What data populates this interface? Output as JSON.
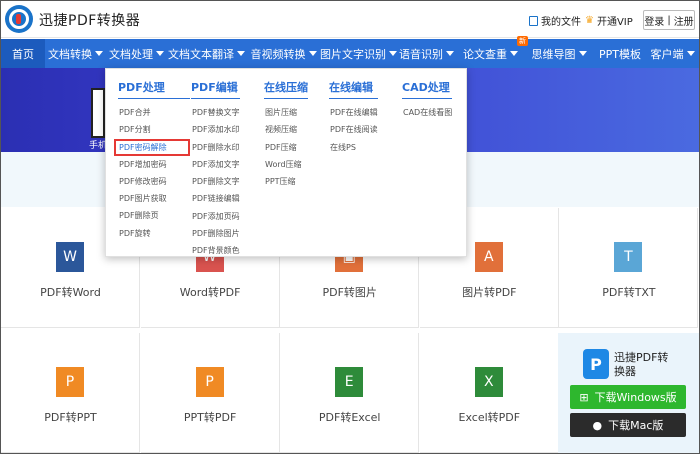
{
  "header": {
    "app_title": "迅捷PDF转换器",
    "my_files": "我的文件",
    "vip": "开通VIP",
    "login": "登录",
    "sep": "|",
    "register": "注册"
  },
  "nav": [
    {
      "label": "首页",
      "caret": false
    },
    {
      "label": "文档转换",
      "caret": true
    },
    {
      "label": "文档处理",
      "caret": true
    },
    {
      "label": "文档文本翻译",
      "caret": true
    },
    {
      "label": "音视频转换",
      "caret": true
    },
    {
      "label": "图片文字识别",
      "caret": true
    },
    {
      "label": "语音识别",
      "caret": true
    },
    {
      "label": "论文查重",
      "caret": true,
      "badge": "新"
    },
    {
      "label": "思维导图",
      "caret": true
    },
    {
      "label": "PPT模板",
      "caret": false
    },
    {
      "label": "客户端",
      "caret": true
    }
  ],
  "banner": {
    "text": "手机"
  },
  "dropdown": {
    "columns": [
      {
        "title": "PDF处理",
        "items": [
          "PDF合并",
          "PDF分割",
          "PDF密码解除",
          "PDF增加密码",
          "PDF修改密码",
          "PDF图片获取",
          "PDF删除页",
          "PDF旋转"
        ],
        "highlight": 2
      },
      {
        "title": "PDF编辑",
        "items": [
          "PDF替换文字",
          "PDF添加水印",
          "PDF删除水印",
          "PDF添加文字",
          "PDF删除文字",
          "PDF链接编辑",
          "PDF添加页码",
          "PDF删除图片",
          "PDF背景颜色"
        ],
        "highlight": -1
      },
      {
        "title": "在线压缩",
        "items": [
          "图片压缩",
          "视频压缩",
          "PDF压缩",
          "Word压缩",
          "PPT压缩"
        ],
        "highlight": -1
      },
      {
        "title": "在线编辑",
        "items": [
          "PDF在线编辑",
          "PDF在线阅读",
          "在线PS"
        ],
        "highlight": -1
      },
      {
        "title": "CAD处理",
        "items": [
          "CAD在线看图"
        ],
        "highlight": -1
      }
    ]
  },
  "tiles": [
    {
      "label": "PDF转Word",
      "icon": "W",
      "color": "#2b579a",
      "row": 0,
      "col": 0
    },
    {
      "label": "Word转PDF",
      "icon": "W",
      "color": "#d9534f",
      "row": 0,
      "col": 1
    },
    {
      "label": "PDF转图片",
      "icon": "▣",
      "color": "#e1703a",
      "row": 0,
      "col": 2
    },
    {
      "label": "图片转PDF",
      "icon": "A",
      "color": "#e1703a",
      "row": 0,
      "col": 3
    },
    {
      "label": "PDF转TXT",
      "icon": "T",
      "color": "#5aa6d6",
      "row": 0,
      "col": 4
    },
    {
      "label": "PDF转PPT",
      "icon": "P",
      "color": "#f08a24",
      "row": 1,
      "col": 0
    },
    {
      "label": "PPT转PDF",
      "icon": "P",
      "color": "#f08a24",
      "row": 1,
      "col": 1
    },
    {
      "label": "PDF转Excel",
      "icon": "E",
      "color": "#2e8b3a",
      "row": 1,
      "col": 2
    },
    {
      "label": "Excel转PDF",
      "icon": "X",
      "color": "#2e8b3a",
      "row": 1,
      "col": 3
    }
  ],
  "promo": {
    "title": "迅捷PDF转换器",
    "win_button": "下载Windows版",
    "mac_button": "下载Mac版"
  }
}
